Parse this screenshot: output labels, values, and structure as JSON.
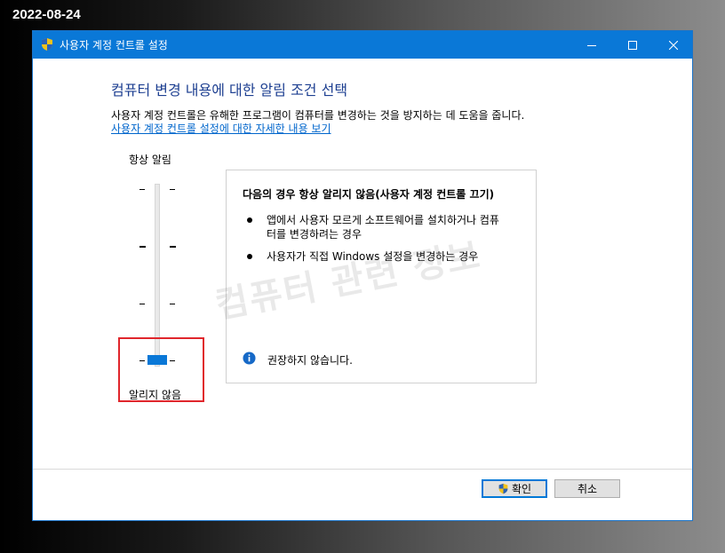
{
  "date_stamp": "2022-08-24",
  "window": {
    "title": "사용자 계정 컨트롤 설정",
    "titlebar_color": "#0a78d7",
    "controls": [
      "minimize-icon",
      "maximize-icon",
      "close-icon"
    ]
  },
  "main": {
    "heading": "컴퓨터 변경 내용에 대한 알림 조건 선택",
    "description": "사용자 계정 컨트롤은 유해한 프로그램이 컴퓨터를 변경하는 것을 방지하는 데 도움을 줍니다.",
    "help_link": "사용자 계정 컨트롤 설정에 대한 자세한 내용 보기"
  },
  "slider": {
    "label_top": "항상 알림",
    "label_bottom": "알리지 않음",
    "levels": 4,
    "selected_level": 1,
    "accent_color": "#0a78d7",
    "highlight_color": "#e0262c"
  },
  "info_panel": {
    "heading": "다음의 경우 항상 알리지 않음(사용자 계정 컨트롤 끄기)",
    "bullets": [
      {
        "line1": "앱에서 사용자 모르게 소프트웨어를 설치하거나 컴퓨",
        "line2": "터를 변경하려는 경우"
      },
      {
        "line1": "사용자가 직접 Windows 설정을 변경하는 경우",
        "line2": ""
      }
    ],
    "note": "권장하지 않습니다.",
    "note_icon": "info-icon"
  },
  "watermark": "컴퓨터 관련 정보",
  "buttons": {
    "ok": "확인",
    "cancel": "취소"
  }
}
